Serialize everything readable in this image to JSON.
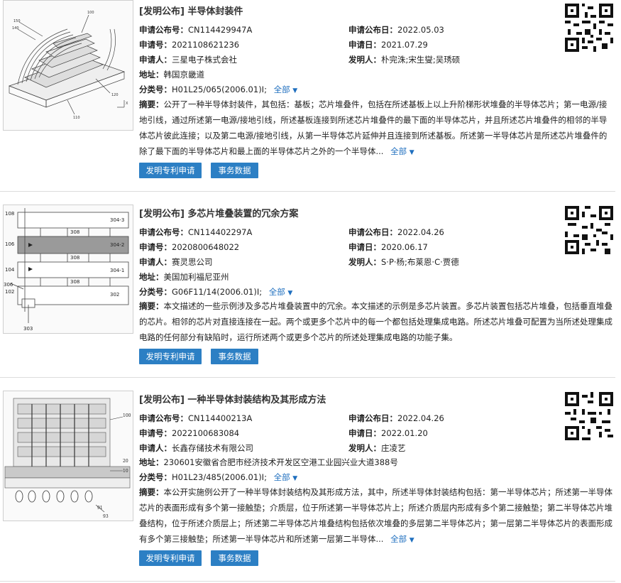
{
  "labels": {
    "pub_no": "申请公布号：",
    "pub_date": "申请公布日：",
    "app_no": "申请号：",
    "app_date": "申请日：",
    "applicant": "申请人：",
    "inventor": "发明人：",
    "address": "地址：",
    "class": "分类号：",
    "abstract": "摘要：",
    "expand_all": "全部",
    "expand_icon": "chevron-down-icon"
  },
  "buttons": {
    "apply": "发明专利申请",
    "affairs": "事务数据"
  },
  "colors": {
    "link": "#1f6fbf",
    "button": "#2c7fc4",
    "divider": "#dcdcdc"
  },
  "records": [
    {
      "title": "[发明公布] 半导体封装件",
      "pub_no": "CN114429947A",
      "pub_date": "2022.05.03",
      "app_no": "2021108621236",
      "app_date": "2021.07.29",
      "applicant": "三星电子株式会社",
      "inventor": "朴完洙;宋生燮;吴琇硕",
      "address": "韩国京畿道",
      "class": "H01L25/065(2006.01)I;",
      "abstract": "公开了一种半导体封装件，其包括：基板；芯片堆叠件，包括在所述基板上以上升阶梯形状堆叠的半导体芯片；第一电源/接地引线，通过所述第一电源/接地引线，所述基板连接到所述芯片堆叠件的最下面的半导体芯片，并且所述芯片堆叠件的相邻的半导体芯片彼此连接；以及第二电源/接地引线，从第一半导体芯片延伸并且连接到所述基板。所述第一半导体芯片是所述芯片堆叠件的除了最下面的半导体芯片和最上面的半导体芯片之外的一个半导体...",
      "abstract_expand": "全部"
    },
    {
      "title": "[发明公布] 多芯片堆叠装置的冗余方案",
      "pub_no": "CN114402297A",
      "pub_date": "2022.04.26",
      "app_no": "2020800648022",
      "app_date": "2020.06.17",
      "applicant": "赛灵思公司",
      "inventor": "S·P·杨;布莱恩·C·贾德",
      "address": "美国加利福尼亚州",
      "class": "G06F11/14(2006.01)I;",
      "abstract": "本文描述的一些示例涉及多芯片堆叠装置中的冗余。本文描述的示例是多芯片装置。多芯片装置包括芯片堆叠，包括垂直堆叠的芯片。相邻的芯片对直接连接在一起。两个或更多个芯片中的每一个都包括处理集成电路。所述芯片堆叠可配置为当所述处理集成电路的任何部分有缺陷时，运行所述两个或更多个芯片的所述处理集成电路的功能子集。",
      "abstract_expand": ""
    },
    {
      "title": "[发明公布] 一种半导体封装结构及其形成方法",
      "pub_no": "CN114400213A",
      "pub_date": "2022.04.26",
      "app_no": "2022100683084",
      "app_date": "2022.01.20",
      "applicant": "长鑫存储技术有限公司",
      "inventor": "庄凌艺",
      "address": "230601安徽省合肥市经济技术开发区空港工业园兴业大道388号",
      "class": "H01L23/485(2006.01)I;",
      "abstract": "本公开实施例公开了一种半导体封装结构及其形成方法，其中，所述半导体封装结构包括：第一半导体芯片；所述第一半导体芯片的表面形成有多个第一接触垫；介质层，位于所述第一半导体芯片上；所述介质层内形成有多个第二接触垫；第二半导体芯片堆叠结构，位于所述介质层上；所述第二半导体芯片堆叠结构包括依次堆叠的多层第二半导体芯片；第一层第二半导体芯片的表面形成有多个第三接触垫；所述第一半导体芯片和所述第一层第二半导体...",
      "abstract_expand": "全部"
    }
  ]
}
